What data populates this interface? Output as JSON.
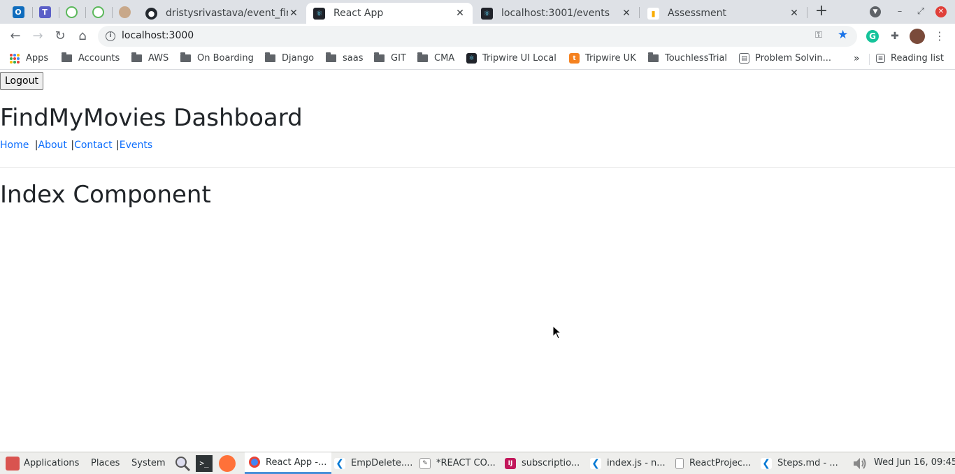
{
  "browser": {
    "tabs": [
      {
        "title": "dristysrivastava/event_find",
        "icon": "github-icon"
      },
      {
        "title": "React App",
        "icon": "react-icon"
      },
      {
        "title": "localhost:3001/events",
        "icon": "react-icon"
      },
      {
        "title": "Assessment",
        "icon": "analytics-icon"
      }
    ],
    "new_tab_symbol": "+",
    "url": "localhost:3000",
    "reading_list": "Reading list",
    "bookmarks_overflow": "»"
  },
  "bookmarks": [
    {
      "label": "Apps",
      "icon": "apps-grid-icon"
    },
    {
      "label": "Accounts",
      "icon": "folder-icon"
    },
    {
      "label": "AWS",
      "icon": "folder-icon"
    },
    {
      "label": "On Boarding",
      "icon": "folder-icon"
    },
    {
      "label": "Django",
      "icon": "folder-icon"
    },
    {
      "label": "saas",
      "icon": "folder-icon"
    },
    {
      "label": "GIT",
      "icon": "folder-icon"
    },
    {
      "label": "CMA",
      "icon": "folder-icon"
    },
    {
      "label": "Tripwire UI Local",
      "icon": "react-icon"
    },
    {
      "label": "Tripwire UK",
      "icon": "tripwire-icon"
    },
    {
      "label": "TouchlessTrial",
      "icon": "folder-icon"
    },
    {
      "label": "Problem Solvin...",
      "icon": "document-icon"
    }
  ],
  "page": {
    "logout_label": "Logout",
    "title": "FindMyMovies Dashboard",
    "nav": {
      "home": "Home",
      "about": "About",
      "contact": "Contact",
      "events": "Events",
      "separator": "|"
    },
    "component_title": "Index Component"
  },
  "taskbar": {
    "menus": [
      "Applications",
      "Places",
      "System"
    ],
    "windows": [
      {
        "label": "React App -...",
        "icon": "chrome-icon"
      },
      {
        "label": "EmpDelete....",
        "icon": "vscode-icon"
      },
      {
        "label": "*REACT CO...",
        "icon": "text-editor-icon"
      },
      {
        "label": "subscriptio...",
        "icon": "intellij-icon"
      },
      {
        "label": "index.js - n...",
        "icon": "vscode-icon"
      },
      {
        "label": "ReactProjec...",
        "icon": "document-icon"
      },
      {
        "label": "Steps.md - ...",
        "icon": "vscode-icon"
      }
    ],
    "clock": "Wed Jun 16, 09:45"
  },
  "colors": {
    "link": "#0d6efd",
    "accent": "#1a73e8",
    "tab_strip": "#dee1e6"
  }
}
